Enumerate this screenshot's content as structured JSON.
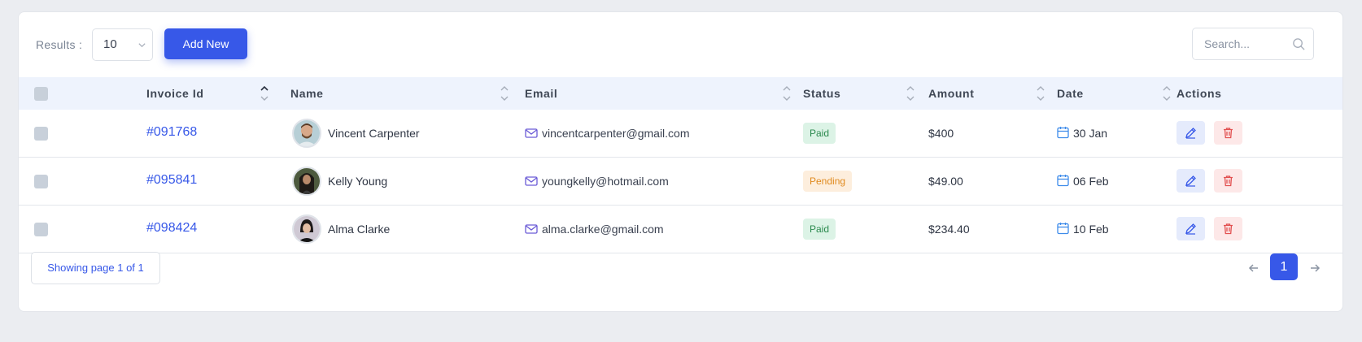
{
  "toolbar": {
    "results_label": "Results :",
    "results_value": "10",
    "add_button": "Add New",
    "search_placeholder": "Search..."
  },
  "columns": [
    "Invoice Id",
    "Name",
    "Email",
    "Status",
    "Amount",
    "Date",
    "Actions"
  ],
  "rows": [
    {
      "invoice": "#091768",
      "name": "Vincent Carpenter",
      "email": "vincentcarpenter@gmail.com",
      "status": "Paid",
      "amount": "$400",
      "date": "30 Jan"
    },
    {
      "invoice": "#095841",
      "name": "Kelly Young",
      "email": "youngkelly@hotmail.com",
      "status": "Pending",
      "amount": "$49.00",
      "date": "06 Feb"
    },
    {
      "invoice": "#098424",
      "name": "Alma Clarke",
      "email": "alma.clarke@gmail.com",
      "status": "Paid",
      "amount": "$234.40",
      "date": "10 Feb"
    }
  ],
  "pagination": {
    "info": "Showing page 1 of 1",
    "current_page": "1"
  },
  "colors": {
    "primary": "#3758e8",
    "paid_bg": "#dcf3e6",
    "paid_text": "#2b8a4e",
    "pending_bg": "#fdeedd",
    "pending_text": "#e08a1e",
    "delete": "#e25050"
  },
  "icons": [
    "chevron-down-icon",
    "search-icon",
    "sort-icon",
    "mail-icon",
    "calendar-icon",
    "edit-icon",
    "trash-icon",
    "arrow-left-icon",
    "arrow-right-icon"
  ]
}
